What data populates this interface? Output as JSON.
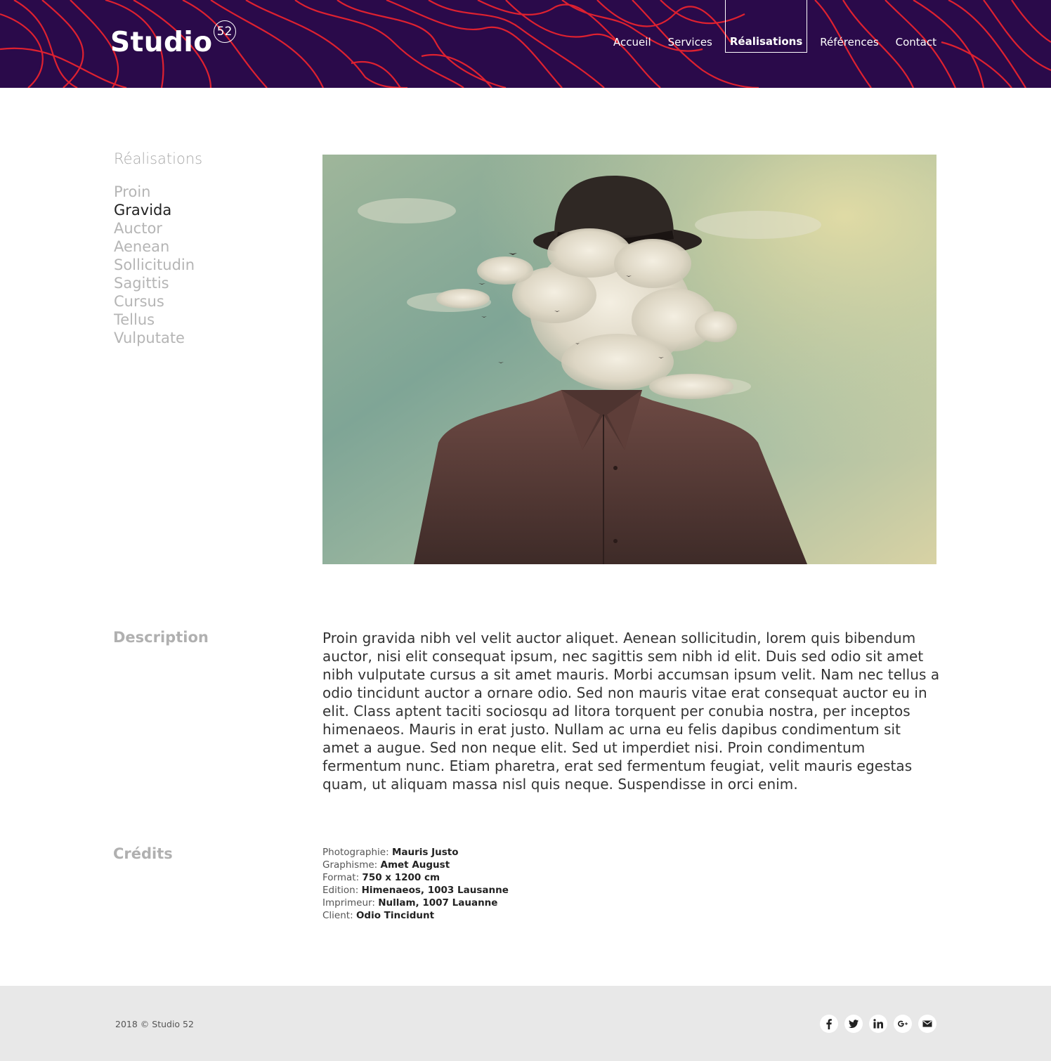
{
  "header": {
    "logo_text": "Studio",
    "logo_badge": "52",
    "nav": [
      {
        "label": "Accueil",
        "active": false
      },
      {
        "label": "Services",
        "active": false
      },
      {
        "label": "Réalisations",
        "active": true
      },
      {
        "label": "Références",
        "active": false
      },
      {
        "label": "Contact",
        "active": false
      }
    ],
    "colors": {
      "background": "#2a0a4a",
      "wave": "#e8232f"
    }
  },
  "sidebar": {
    "title": "Réalisations",
    "projects": [
      "Proin",
      "Gravida",
      "Auctor",
      "Aenean",
      "Sollicitudin",
      "Sagittis",
      "Cursus",
      "Tellus",
      "Vulputate"
    ],
    "current": "Gravida"
  },
  "description": {
    "label": "Description",
    "text": "Proin gravida nibh vel velit auctor aliquet. Aenean sollicitudin, lorem quis bibendum auctor, nisi elit consequat ipsum, nec sagittis sem nibh id elit. Duis sed odio sit amet nibh vulputate cursus a sit amet mauris. Morbi accumsan ipsum velit. Nam nec tellus a odio tincidunt auctor a ornare odio. Sed non  mauris vitae erat consequat auctor eu in elit. Class aptent taciti sociosqu ad litora torquent per conubia nostra, per inceptos himenaeos. Mauris in erat justo. Nullam ac urna eu felis dapibus condimentum sit amet a augue. Sed non neque elit. Sed ut imperdiet nisi. Proin condimentum fermentum nunc. Etiam pharetra, erat sed fermentum feugiat, velit mauris egestas quam, ut aliquam massa nisl quis neque. Suspendisse in orci enim."
  },
  "credits": {
    "label": "Crédits",
    "items": [
      {
        "key": "Photographie:",
        "value": "Mauris Justo"
      },
      {
        "key": "Graphisme:",
        "value": "Amet August"
      },
      {
        "key": "Format:",
        "value": "750 x 1200 cm"
      },
      {
        "key": "Edition:",
        "value": "Himenaeos, 1003 Lausanne"
      },
      {
        "key": "Imprimeur:",
        "value": "Nullam, 1007 Lauanne"
      },
      {
        "key": "Client:",
        "value": "Odio Tincidunt"
      }
    ]
  },
  "footer": {
    "copyright": "2018 © Studio 52",
    "social": [
      {
        "icon": "facebook-icon"
      },
      {
        "icon": "twitter-icon"
      },
      {
        "icon": "linkedin-icon"
      },
      {
        "icon": "google-plus-icon"
      },
      {
        "icon": "mail-icon"
      }
    ]
  }
}
